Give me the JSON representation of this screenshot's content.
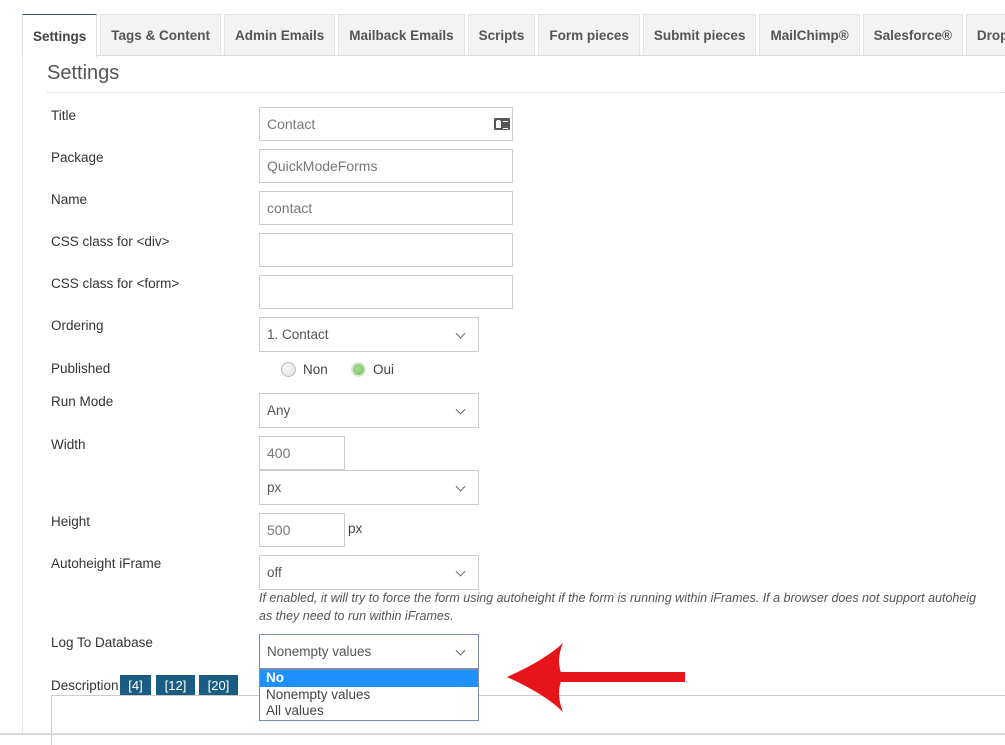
{
  "tabs": [
    {
      "label": "Settings",
      "active": true
    },
    {
      "label": "Tags & Content",
      "active": false
    },
    {
      "label": "Admin Emails",
      "active": false
    },
    {
      "label": "Mailback Emails",
      "active": false
    },
    {
      "label": "Scripts",
      "active": false
    },
    {
      "label": "Form pieces",
      "active": false
    },
    {
      "label": "Submit pieces",
      "active": false
    },
    {
      "label": "MailChimp®",
      "active": false
    },
    {
      "label": "Salesforce®",
      "active": false
    },
    {
      "label": "Dropbox®",
      "active": false
    }
  ],
  "section_title": "Settings",
  "fields": {
    "title": {
      "label": "Title",
      "value": "Contact",
      "icon": "id-card-icon"
    },
    "package": {
      "label": "Package",
      "value": "QuickModeForms"
    },
    "name": {
      "label": "Name",
      "value": "contact"
    },
    "css_div": {
      "label": "CSS class for <div>",
      "value": ""
    },
    "css_form": {
      "label": "CSS class for <form>",
      "value": ""
    },
    "ordering": {
      "label": "Ordering",
      "value": "1. Contact"
    },
    "published": {
      "label": "Published",
      "options": [
        "Non",
        "Oui"
      ],
      "selected": "Oui"
    },
    "run_mode": {
      "label": "Run Mode",
      "value": "Any"
    },
    "width": {
      "label": "Width",
      "value": "400",
      "unit": "px"
    },
    "height": {
      "label": "Height",
      "value": "500",
      "unit": "px"
    },
    "autoheight": {
      "label": "Autoheight iFrame",
      "value": "off",
      "help_line1": "If enabled, it will try to force the form using autoheight if the form is running within iFrames. If a browser does not support autoheig",
      "help_line2": "as they need to run within iFrames."
    },
    "log_db": {
      "label": "Log To Database",
      "value": "Nonempty values",
      "options": [
        "No",
        "Nonempty values",
        "All values"
      ],
      "highlighted": "No"
    },
    "description": {
      "label": "Description",
      "size_buttons": [
        "[4]",
        "[12]",
        "[20]"
      ],
      "value": ""
    }
  },
  "annotation": {
    "type": "arrow",
    "color": "#e8141b",
    "points_to": "log-to-database-dropdown"
  }
}
